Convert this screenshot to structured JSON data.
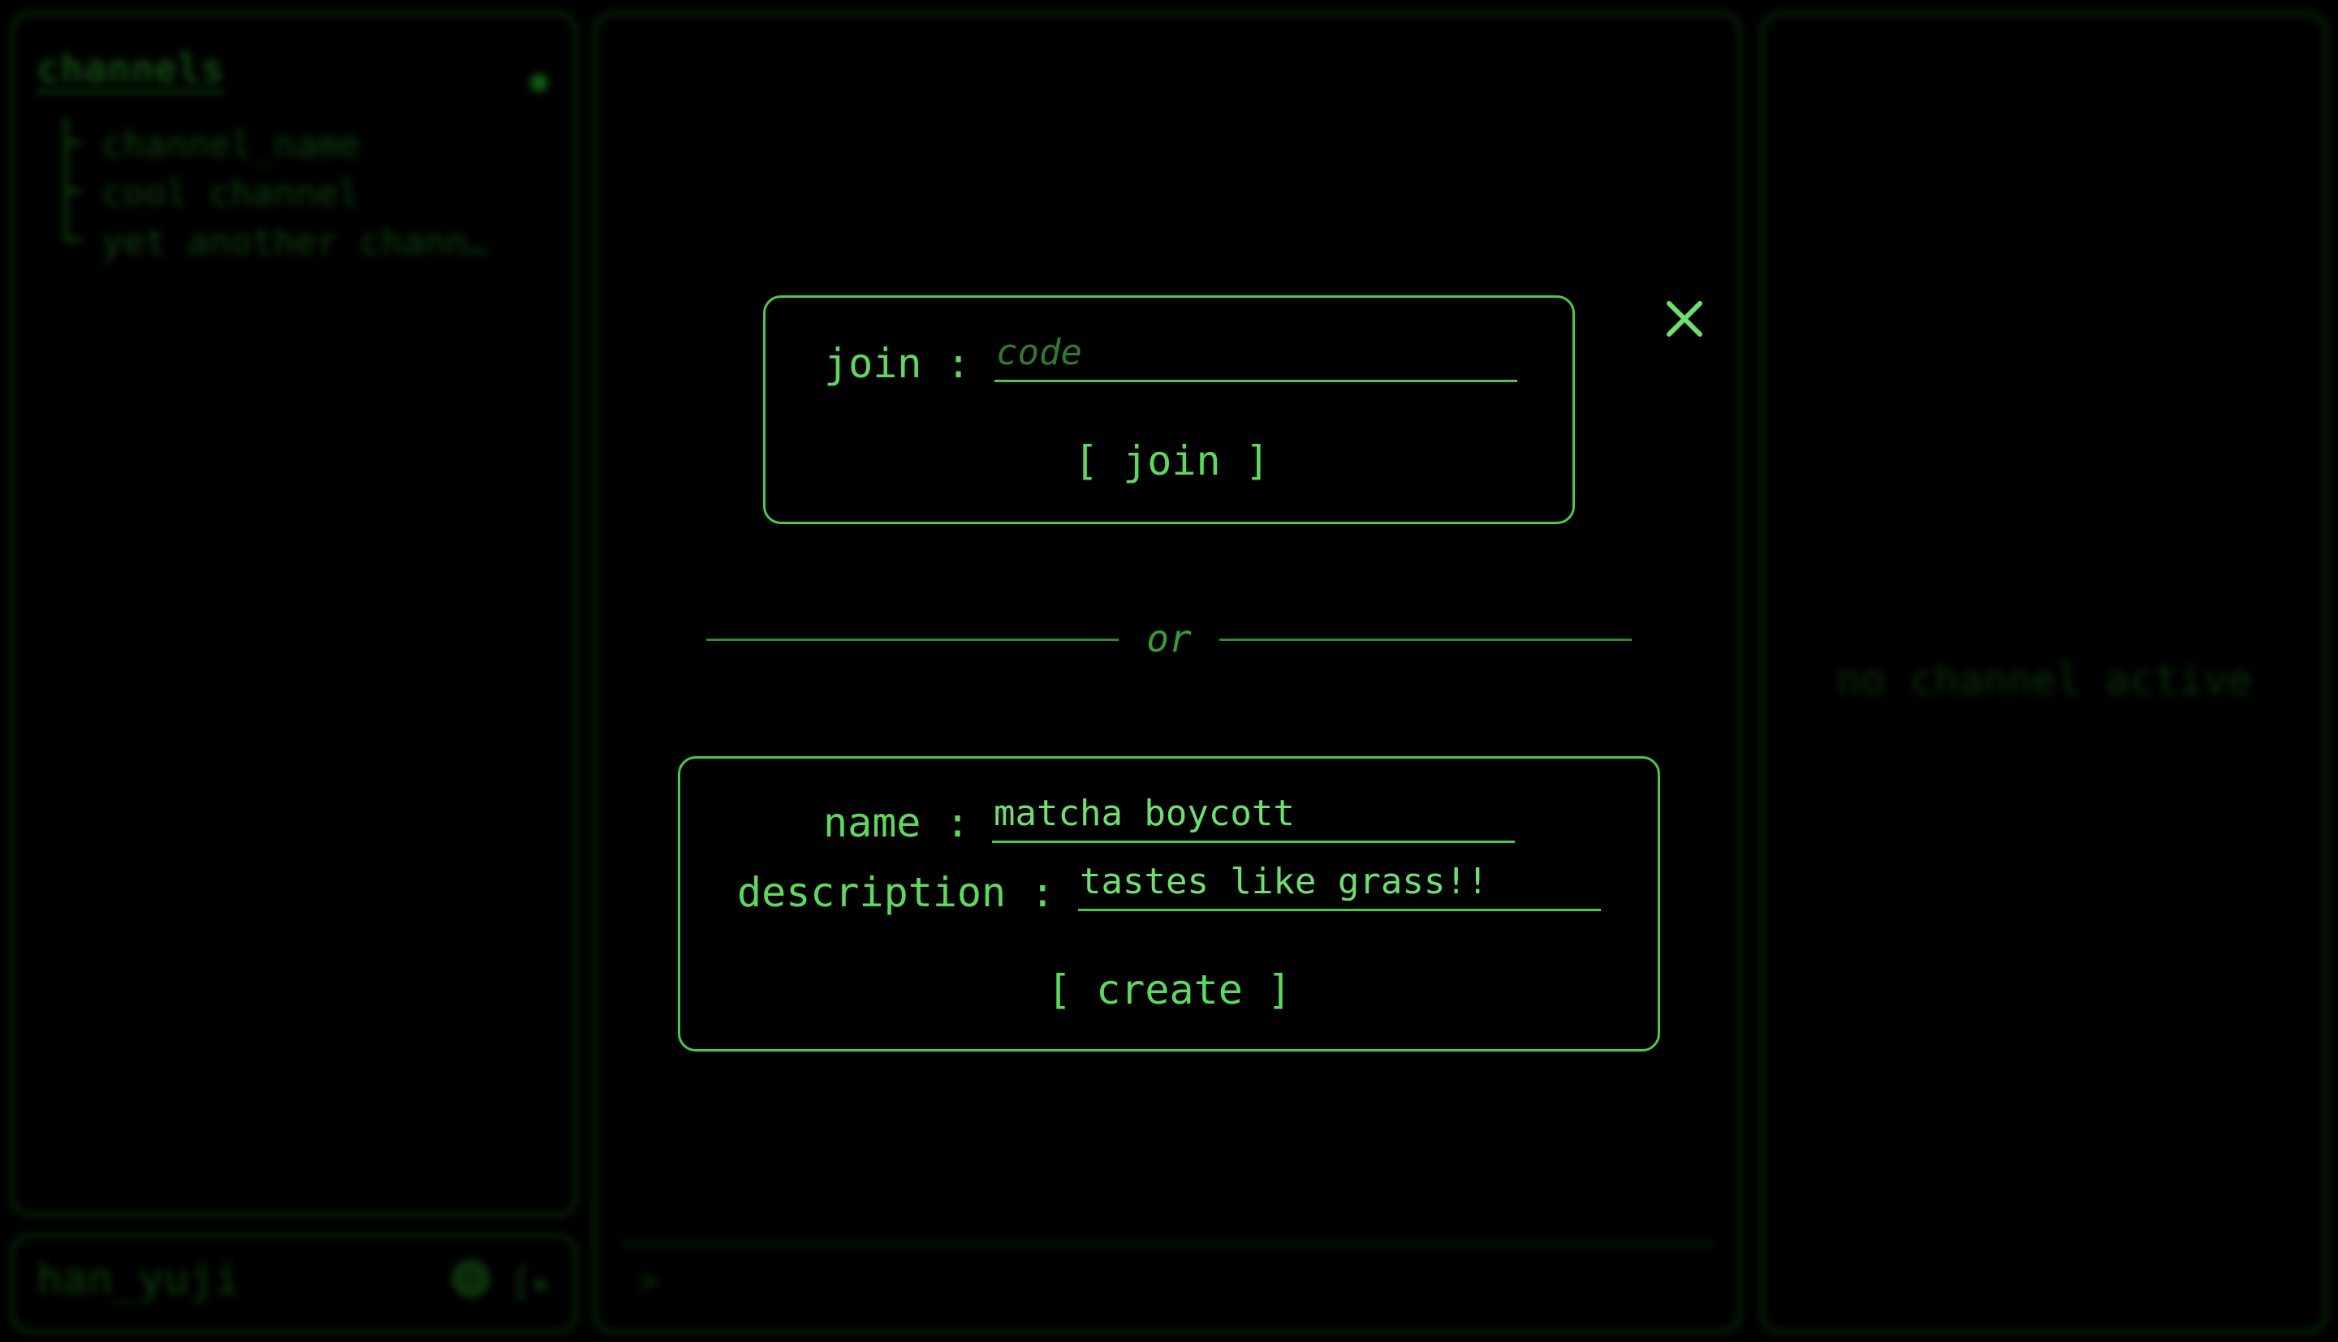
{
  "sidebar": {
    "title": "channels",
    "channels": [
      "channel_name",
      "cool channel",
      "yet another chann…"
    ]
  },
  "user": {
    "name": "han_yuji",
    "settings_icon": "gear-icon",
    "logout_icon": "logout-icon"
  },
  "main": {
    "prompt": ">"
  },
  "right_panel": {
    "empty_text": "no channel active"
  },
  "modal": {
    "join": {
      "label": "join :",
      "placeholder": "code",
      "value": "",
      "button": "[ join ]"
    },
    "separator": "or",
    "create": {
      "name_label": "name :",
      "name_value": "matcha boycott",
      "description_label": "description :",
      "description_value": "tastes like grass!!",
      "button": "[ create ]"
    },
    "close_icon": "close-icon"
  },
  "colors": {
    "accent": "#4cc94c",
    "text": "#5fd85f",
    "background": "#000000",
    "dim_border": "#0a2a0a"
  }
}
